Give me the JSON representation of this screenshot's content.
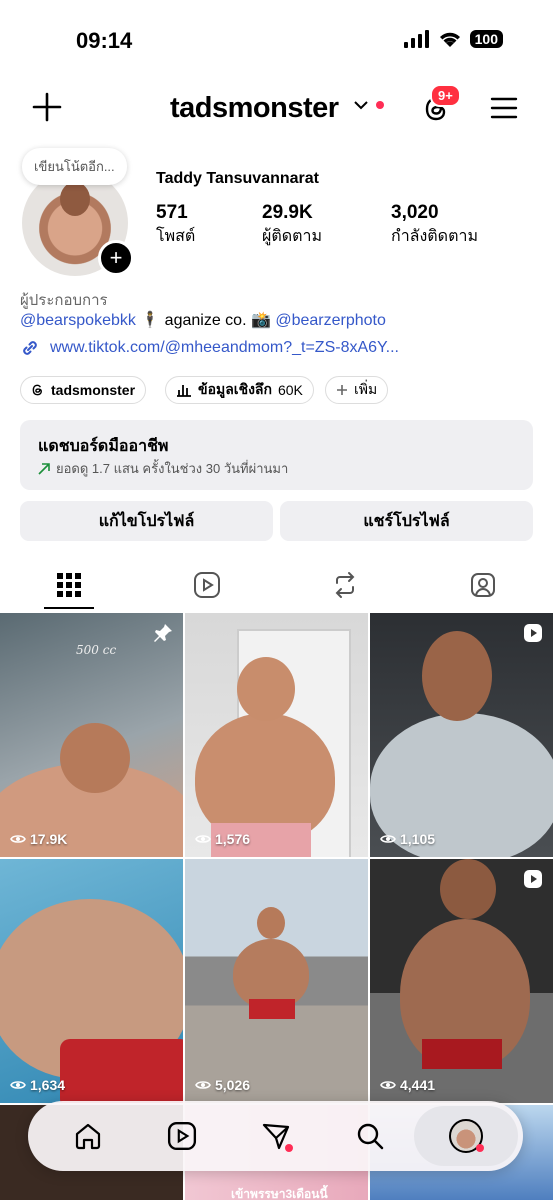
{
  "status": {
    "time": "09:14",
    "battery": "100"
  },
  "header": {
    "username": "tadsmonster",
    "badge": "9+"
  },
  "profile": {
    "note": "เขียนโน้ตอีก...",
    "full_name": "Taddy Tansuvannarat",
    "stats": [
      {
        "value": "571",
        "label": "โพสต์"
      },
      {
        "value": "29.9K",
        "label": "ผู้ติดตาม"
      },
      {
        "value": "3,020",
        "label": "กำลังติดตาม"
      }
    ],
    "category": "ผู้ประกอบการ",
    "bio_mention1": "@bearspokebkk",
    "bio_text": "🕴 aganize co. 📸",
    "bio_mention2": "@bearzerphoto",
    "website": "www.tiktok.com/@mheeandmom?_t=ZS-8xA6Y..."
  },
  "pills": {
    "threads": "tadsmonster",
    "insights_label": "ข้อมูลเชิงลึก",
    "insights_value": "60K",
    "add": "เพิ่ม"
  },
  "dashboard": {
    "title": "แดชบอร์ดมืออาชีพ",
    "subtitle": "ยอดดู 1.7 แสน ครั้งในช่วง 30 วันที่ผ่านมา"
  },
  "buttons": {
    "edit": "แก้ไขโปรไฟล์",
    "share": "แชร์โปรไฟล์"
  },
  "grid": {
    "tile1_caption": "500 cc",
    "views": [
      "17.9K",
      "1,576",
      "1,105",
      "1,634",
      "5,026",
      "4,441"
    ],
    "bottom_caption": "เข้าพรรษา3เดือนนี้"
  },
  "colors": {
    "link": "#3558c9",
    "accent_red": "#ff3040"
  }
}
